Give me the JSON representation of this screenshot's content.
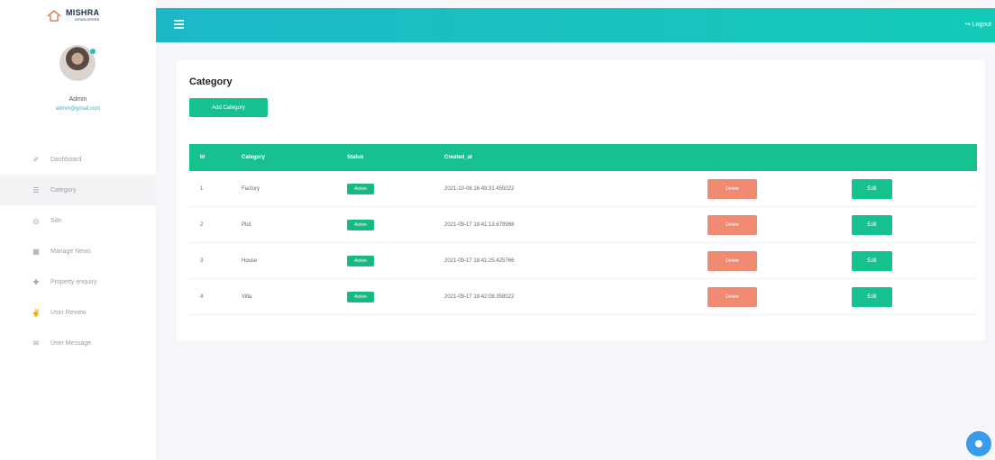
{
  "brand": {
    "name": "MISHRA",
    "sub": "DEVELOPERS",
    "accent": "#20c4c0"
  },
  "user": {
    "name": "Admin",
    "email": "admin@gmail.com"
  },
  "sidebar": {
    "items": [
      {
        "label": "Dashboard",
        "icon": "brush-icon"
      },
      {
        "label": "Category",
        "icon": "list-icon"
      },
      {
        "label": "Site",
        "icon": "location-icon"
      },
      {
        "label": "Manage News",
        "icon": "grid-icon"
      },
      {
        "label": "Property enquiry",
        "icon": "plus-icon"
      },
      {
        "label": "User Review",
        "icon": "thumbs-up-icon"
      },
      {
        "label": "User Message",
        "icon": "message-icon"
      }
    ]
  },
  "topbar": {
    "logout_label": "Logout"
  },
  "page": {
    "title": "Category",
    "add_button": "Add Category"
  },
  "table": {
    "headers": [
      "Id",
      "Category",
      "Status",
      "Created_at"
    ],
    "rows": [
      {
        "id": "1",
        "category": "Factory",
        "status": "Active",
        "created": "2021-10-06 16:49:31.455022",
        "delete": "Delete",
        "edit": "Edit"
      },
      {
        "id": "2",
        "category": "Plot",
        "status": "Active",
        "created": "2021-09-17 18:41:13.679968",
        "delete": "Delete",
        "edit": "Edit"
      },
      {
        "id": "3",
        "category": "House",
        "status": "Active",
        "created": "2021-09-17 18:41:25.425766",
        "delete": "Delete",
        "edit": "Edit"
      },
      {
        "id": "4",
        "category": "Villa",
        "status": "Active",
        "created": "2021-09-17 18:42:08.359022",
        "delete": "Delete",
        "edit": "Edit"
      }
    ]
  },
  "colors": {
    "primary": "#17c18f",
    "danger": "#f08a73",
    "topbar": "#1db8c8"
  }
}
